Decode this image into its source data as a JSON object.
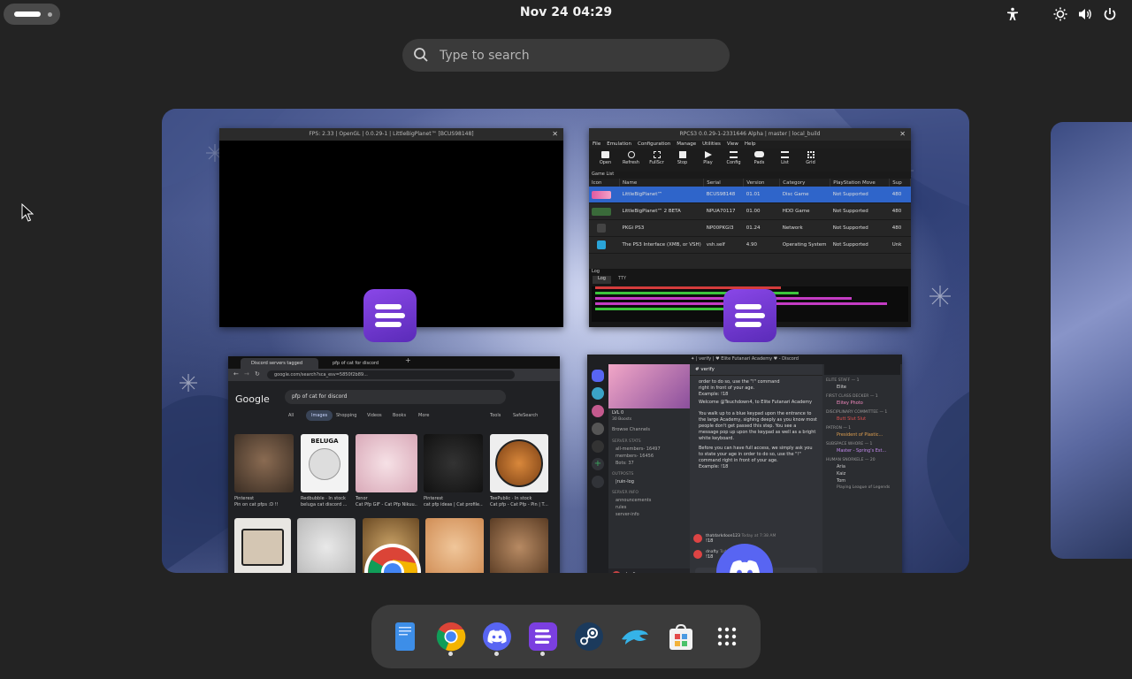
{
  "topbar": {
    "clock": "Nov 24  04:29"
  },
  "search": {
    "placeholder": "Type to search"
  },
  "windows": {
    "game_window": {
      "title": "FPS: 2.33 | OpenGL | 0.0.29-1 | LittleBigPlanet™ [BCUS98148]"
    },
    "rpcs3_main": {
      "title": "RPCS3 0.0.29-1-2331646 Alpha | master | local_build",
      "menu": [
        "File",
        "Emulation",
        "Configuration",
        "Manage",
        "Utilities",
        "View",
        "Help"
      ],
      "toolbar": [
        "Open",
        "Refresh",
        "FullScr",
        "Stop",
        "Play",
        "Config",
        "Pads",
        "List",
        "Grid"
      ],
      "game_list_label": "Game List",
      "columns": [
        "Icon",
        "Name",
        "Serial",
        "Version",
        "Category",
        "PlayStation Move",
        "Sup"
      ],
      "rows": [
        {
          "name": "LittleBigPlanet™",
          "serial": "BCUS98148",
          "version": "01.01",
          "category": "Disc Game",
          "move": "Not Supported",
          "sup": "480"
        },
        {
          "name": "LittleBigPlanet™ 2 BETA",
          "serial": "NPUA70117",
          "version": "01.00",
          "category": "HDD Game",
          "move": "Not Supported",
          "sup": "480"
        },
        {
          "name": "PKGi PS3",
          "serial": "NP00PKGI3",
          "version": "01.24",
          "category": "Network",
          "move": "Not Supported",
          "sup": "480"
        },
        {
          "name": "The PS3 Interface (XMB, or VSH)",
          "serial": "vsh.self",
          "version": "4.90",
          "category": "Operating System",
          "move": "Not Supported",
          "sup": "Unk"
        }
      ],
      "log_label": "Log",
      "log_tabs": [
        "Log",
        "TTY"
      ]
    },
    "chrome": {
      "tabs": [
        "Discord servers tagged",
        "pfp of cat for discord"
      ],
      "url": "google.com/search?sca_esv=5850f2b89...",
      "logo": "Google",
      "query": "pfp of cat for discord",
      "filters": [
        "All",
        "Images",
        "Shopping",
        "Videos",
        "Books",
        "More"
      ],
      "tools": "Tools",
      "safesearch": "SafeSearch",
      "results": [
        {
          "source": "Pinterest",
          "caption": "Pin on cat pfps :D !!"
        },
        {
          "source": "Redbubble · In stock",
          "caption": "beluga cat discord ..."
        },
        {
          "source": "Tenor",
          "caption": "Cat Pfp GIF - Cat Pfp Nikuu..."
        },
        {
          "source": "Pinterest",
          "caption": "cat pfp ideas | Cat profile..."
        },
        {
          "source": "TeePublic · In stock",
          "caption": "Cat pfp - Cat Pfp - Pin | T..."
        }
      ],
      "beluga_label": "BELUGA"
    },
    "discord": {
      "title": "✦ | verify | ♥ Elite Futanari Academy ♥ - Discord",
      "channel": "verify",
      "server": "Elite Futanari Academy ♥",
      "level": "LVL 0",
      "boosts": "30 Boosts",
      "browse": "Browse Channels",
      "categories": [
        "SERVER STATS",
        "OUTPOSTS",
        "SERVER INFO"
      ],
      "stat_channels": [
        "all-members- 16497",
        "members- 16456",
        "Bots: 37"
      ],
      "info_channels": [
        "|ruin-log",
        "announcements",
        "rules",
        "server-info"
      ],
      "username": "dnafty",
      "messages": [
        "order to do so, use the \"!\" command",
        "right in front of your age.",
        "Example: !18",
        "Welcome @Teuchdown4, to Elite Futanari Academy",
        "You walk up to a blue keypad upon the entrance to the large Academy, sighing deeply as you know most people don't get passed this step. You see a message pop up upon the keypad as well as a bright white keyboard.",
        "Before you can have full access, we simply ask you to state your age in order to do so, use the \"!\" command right in front of your age.",
        "Example: !18"
      ],
      "chat_users": [
        {
          "name": "thatdarkdoon123",
          "time": "Today at 7:38 AM",
          "text": "!18"
        },
        {
          "name": "dnafty",
          "time": "Today at 8:04 AM",
          "text": "!18"
        }
      ],
      "member_groups": [
        "ELITE STAFF — 1",
        "FIRST CLASS DECKER — 1",
        "DISCIPLINARY COMMITTEE — 1",
        "PATRON — 1",
        "SUBSPACE WHORE — 1",
        "HUMAN SNORKELE — 20"
      ],
      "members": [
        "Elite",
        "Elitey Photo",
        "Butt Slut Slut",
        "President of Plastic...",
        "Master - Spring's Est...",
        "Aria",
        "Kaiz",
        "Tom",
        "Playing League of Legends"
      ]
    }
  },
  "dock": {
    "apps": [
      "Files",
      "Google Chrome",
      "Discord",
      "RPCS3",
      "Steam",
      "Dolphin",
      "Software",
      "Show Apps"
    ]
  },
  "colors": {
    "rpcs3": "#7b3fe0",
    "discord": "#5865f2",
    "selection": "#2f65ca"
  }
}
